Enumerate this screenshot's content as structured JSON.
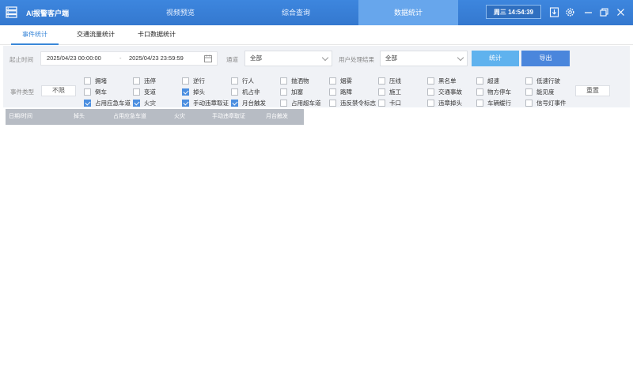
{
  "header": {
    "app_title": "AI报警客户端",
    "tabs": [
      {
        "label": "视频预览"
      },
      {
        "label": "综合查询"
      },
      {
        "label": "数据统计"
      }
    ],
    "clock": "周三 14:54:39",
    "icons": [
      "export-icon",
      "settings-icon",
      "minimize-icon",
      "restore-icon",
      "close-icon"
    ]
  },
  "subtabs": [
    "事件统计",
    "交通流量统计",
    "卡口数据统计"
  ],
  "filters": {
    "time_label": "起止时间",
    "start_time": "2025/04/23 00:00:00",
    "separator": "-",
    "end_time": "2025/04/23 23:59:59",
    "channel_label": "通道",
    "channel_value": "全部",
    "user_result_label": "用户处理结果",
    "user_result_value": "全部",
    "stat_button": "统计",
    "export_button": "导出",
    "event_type_label": "事件类型",
    "unlimited_button": "不限",
    "reset_button": "重置"
  },
  "event_types": [
    {
      "label": "拥堵",
      "checked": false
    },
    {
      "label": "违停",
      "checked": false
    },
    {
      "label": "逆行",
      "checked": false
    },
    {
      "label": "行人",
      "checked": false
    },
    {
      "label": "抛洒物",
      "checked": false
    },
    {
      "label": "烟雾",
      "checked": false
    },
    {
      "label": "压线",
      "checked": false
    },
    {
      "label": "黑名单",
      "checked": false
    },
    {
      "label": "超速",
      "checked": false
    },
    {
      "label": "低速行驶",
      "checked": false
    },
    {
      "label": "倒车",
      "checked": false
    },
    {
      "label": "变道",
      "checked": false
    },
    {
      "label": "掉头",
      "checked": true
    },
    {
      "label": "机占非",
      "checked": false
    },
    {
      "label": "加塞",
      "checked": false
    },
    {
      "label": "路障",
      "checked": false
    },
    {
      "label": "施工",
      "checked": false
    },
    {
      "label": "交通事故",
      "checked": false
    },
    {
      "label": "物方停车",
      "checked": false
    },
    {
      "label": "能见度",
      "checked": false
    },
    {
      "label": "占用应急车道",
      "checked": true
    },
    {
      "label": "火灾",
      "checked": true
    },
    {
      "label": "手动违章取证",
      "checked": true
    },
    {
      "label": "月台触发",
      "checked": true
    },
    {
      "label": "占用超车道",
      "checked": false
    },
    {
      "label": "违反禁令标志",
      "checked": false
    },
    {
      "label": "卡口",
      "checked": false
    },
    {
      "label": "违章掉头",
      "checked": false
    },
    {
      "label": "车辆缓行",
      "checked": false
    },
    {
      "label": "信号灯事件",
      "checked": false
    }
  ],
  "table": {
    "columns": [
      "日期/时间",
      "掉头",
      "占用应急车道",
      "火灾",
      "手动违章取证",
      "月台触发"
    ]
  }
}
